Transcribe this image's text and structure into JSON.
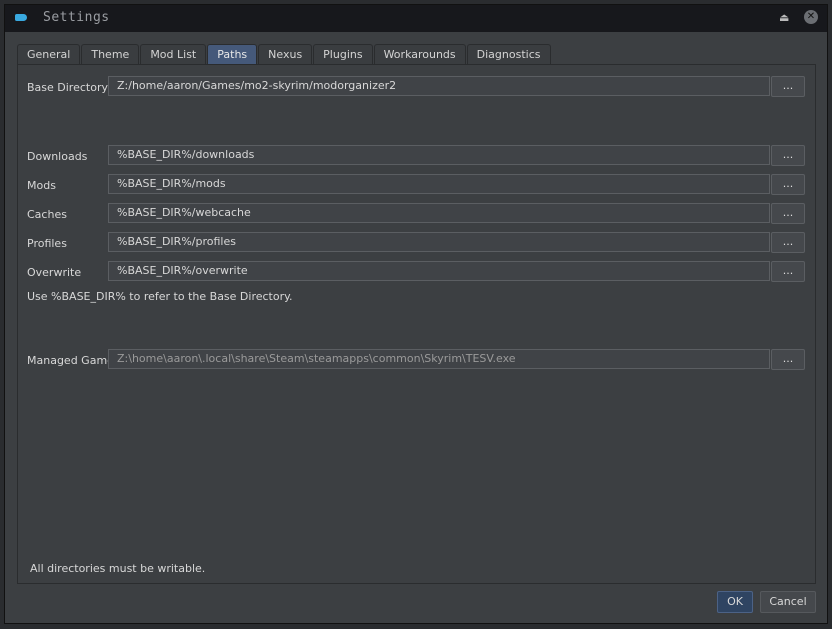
{
  "window": {
    "title": "Settings",
    "shade_icon": "eject-icon",
    "close_icon": "close-icon"
  },
  "tabs": [
    {
      "label": "General"
    },
    {
      "label": "Theme"
    },
    {
      "label": "Mod List"
    },
    {
      "label": "Paths",
      "active": true
    },
    {
      "label": "Nexus"
    },
    {
      "label": "Plugins"
    },
    {
      "label": "Workarounds"
    },
    {
      "label": "Diagnostics"
    }
  ],
  "paths": {
    "base": {
      "label": "Base Directory",
      "value": "Z:/home/aaron/Games/mo2-skyrim/modorganizer2"
    },
    "downloads": {
      "label": "Downloads",
      "value": "%BASE_DIR%/downloads"
    },
    "mods": {
      "label": "Mods",
      "value": "%BASE_DIR%/mods"
    },
    "caches": {
      "label": "Caches",
      "value": "%BASE_DIR%/webcache"
    },
    "profiles": {
      "label": "Profiles",
      "value": "%BASE_DIR%/profiles"
    },
    "overwrite": {
      "label": "Overwrite",
      "value": "%BASE_DIR%/overwrite"
    },
    "hint": "Use %BASE_DIR% to refer to the Base Directory.",
    "managed": {
      "label": "Managed Game",
      "value": "Z:\\home\\aaron\\.local\\share\\Steam\\steamapps\\common\\Skyrim\\TESV.exe"
    },
    "browse": "...",
    "footer": "All directories must be writable."
  },
  "buttons": {
    "ok": "OK",
    "cancel": "Cancel"
  }
}
